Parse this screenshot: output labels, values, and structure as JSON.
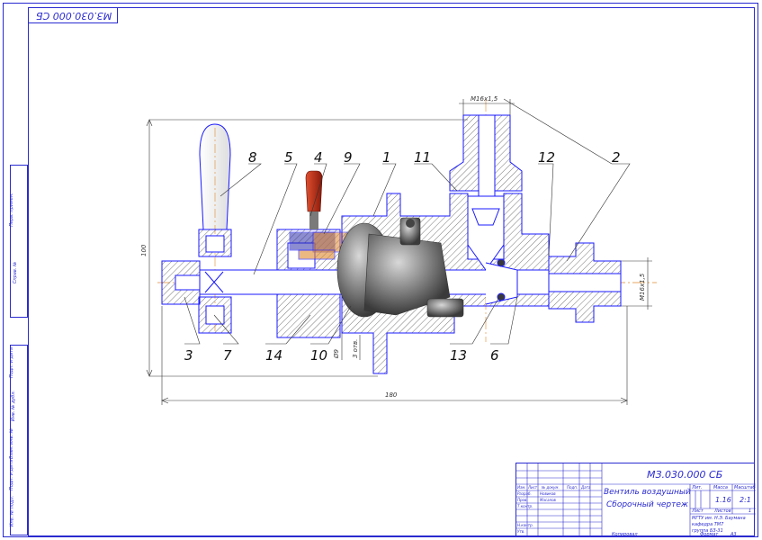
{
  "drawing": {
    "corner_code": "МЗ.030.000 СБ",
    "callouts": [
      "8",
      "5",
      "4",
      "9",
      "1",
      "11",
      "12",
      "2",
      "3",
      "7",
      "14",
      "10",
      "13",
      "6"
    ],
    "dims": {
      "overall_height": "100",
      "overall_length": "180",
      "thread_top": "M16x1,5",
      "thread_right": "M16x1,5",
      "d9": "Ø9",
      "d9_note": "3 отв."
    }
  },
  "left_margin": {
    "perv_primen": "Перв. примен.",
    "sprav": "Справ. №",
    "podp_data_1": "Подп. и дата",
    "inv_dubl": "Инв. № дубл.",
    "vzam_inv": "Взам. инв. №",
    "podp_data_2": "Подп. и дата",
    "inv_podl": "Инв. № подл."
  },
  "title_block": {
    "doc_code": "МЗ.030.000 СБ",
    "name_line1": "Вентиль воздушный",
    "name_line2": "Сборочный чертеж",
    "lit_label": "Лит.",
    "mass_label": "Масса",
    "scale_label": "Масштаб",
    "mass": "1.16",
    "scale": "2:1",
    "sheet_label": "Лист",
    "sheets_label": "Листов",
    "sheets_value": "1",
    "org_line1": "МГТУ им. Н.Э. Баумана",
    "org_line2": "кафедра ТМ7",
    "org_line3": "группа БЗ-31",
    "headers": [
      "Изм.",
      "Лист",
      "№ докум.",
      "Подп.",
      "Дата"
    ],
    "roles": [
      "Разраб.",
      "Пров.",
      "Т.контр.",
      "",
      "Н.контр.",
      "Утв."
    ],
    "names": [
      "Новиков",
      "Масалов"
    ],
    "bottom_copied": "Копировал",
    "bottom_format": "Формат",
    "bottom_format_value": "A3"
  },
  "colors": {
    "frame": "#2a2ad0",
    "outline": "#1010ff",
    "hatch": "#555555",
    "centerline": "#e08a30",
    "metal": "#7a7a7a",
    "valve_red": "#c0301a"
  }
}
